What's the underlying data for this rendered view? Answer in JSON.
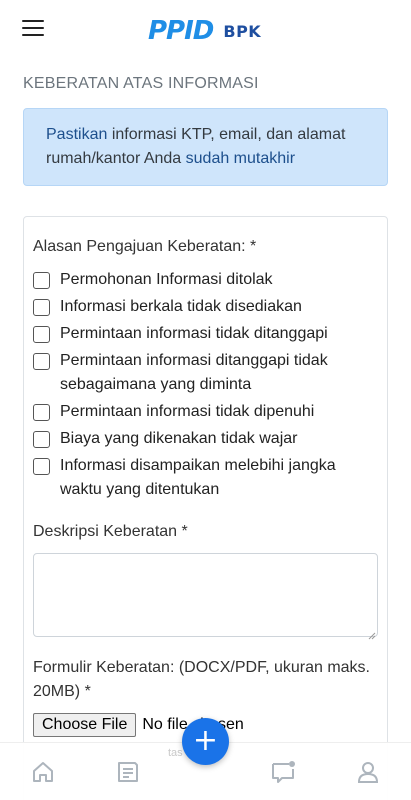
{
  "header": {
    "logo_text": "PPID",
    "logo_sub": "BPK"
  },
  "page": {
    "title": "KEBERATAN ATAS INFORMASI"
  },
  "alert": {
    "part1": "Pastikan",
    "part2": " informasi KTP, email, dan alamat rumah/kantor Anda ",
    "part3": "sudah mutakhir"
  },
  "form": {
    "reasons_label": "Alasan Pengajuan Keberatan: *",
    "reasons": [
      "Permohonan Informasi ditolak",
      "Informasi berkala tidak disediakan",
      "Permintaan informasi tidak ditanggapi",
      "Permintaan informasi ditanggapi tidak sebagaimana yang diminta",
      "Permintaan informasi tidak dipenuhi",
      "Biaya yang dikenakan tidak wajar",
      "Informasi disampaikan melebihi jangka waktu yang ditentukan"
    ],
    "description_label": "Deskripsi Keberatan *",
    "description_value": "",
    "file_label": "Formulir Keberatan: (DOCX/PDF, ukuran maks. 20MB) *",
    "file_button": "Choose File",
    "file_status": "No file chosen"
  },
  "nav": {
    "hint": "tas"
  },
  "fab": {
    "label": "+"
  },
  "colors": {
    "primary": "#1a73e8",
    "alert_bg": "#cfe5fb",
    "alert_highlight": "#1d4f8c"
  }
}
